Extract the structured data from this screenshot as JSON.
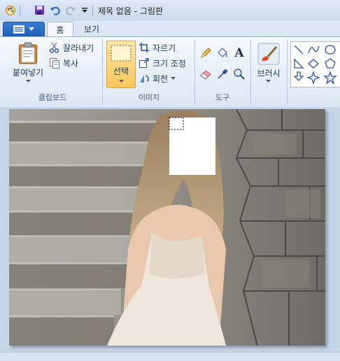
{
  "window": {
    "title": "제목 없음 - 그림판"
  },
  "quick_access": {
    "icons": [
      "paint-app-icon",
      "save-icon",
      "undo-icon",
      "redo-icon",
      "customize-dropdown-icon"
    ]
  },
  "tabs": [
    {
      "label": "홈",
      "selected": true
    },
    {
      "label": "보기",
      "selected": false
    }
  ],
  "ribbon": {
    "clipboard": {
      "group_label": "클립보드",
      "paste_label": "붙여넣기",
      "cut_label": "잘라내기",
      "copy_label": "복사"
    },
    "image": {
      "group_label": "이미지",
      "select_label": "선택",
      "crop_label": "자르기",
      "resize_label": "크기 조정",
      "rotate_label": "회전"
    },
    "tools": {
      "group_label": "도구",
      "items": [
        "pencil-icon",
        "fill-icon",
        "text-icon",
        "eraser-icon",
        "color-picker-icon",
        "magnifier-icon"
      ],
      "text_glyph": "A"
    },
    "brushes": {
      "label": "브러시"
    },
    "shapes": {
      "items": [
        "line-shape",
        "curve-shape",
        "oval-shape",
        "polygon-shape",
        "diamond-shape",
        "pentagon-shape",
        "arrow-shape",
        "star4-shape",
        "star5-shape"
      ]
    }
  },
  "colors": {
    "accent": "#2a6cc4",
    "selected_tool_bg": "#f9c659",
    "workspace_bg": "#c5d5e8"
  },
  "canvas": {
    "content": "photo-of-woman-on-stone-steps",
    "redaction": "white-box-over-face"
  }
}
